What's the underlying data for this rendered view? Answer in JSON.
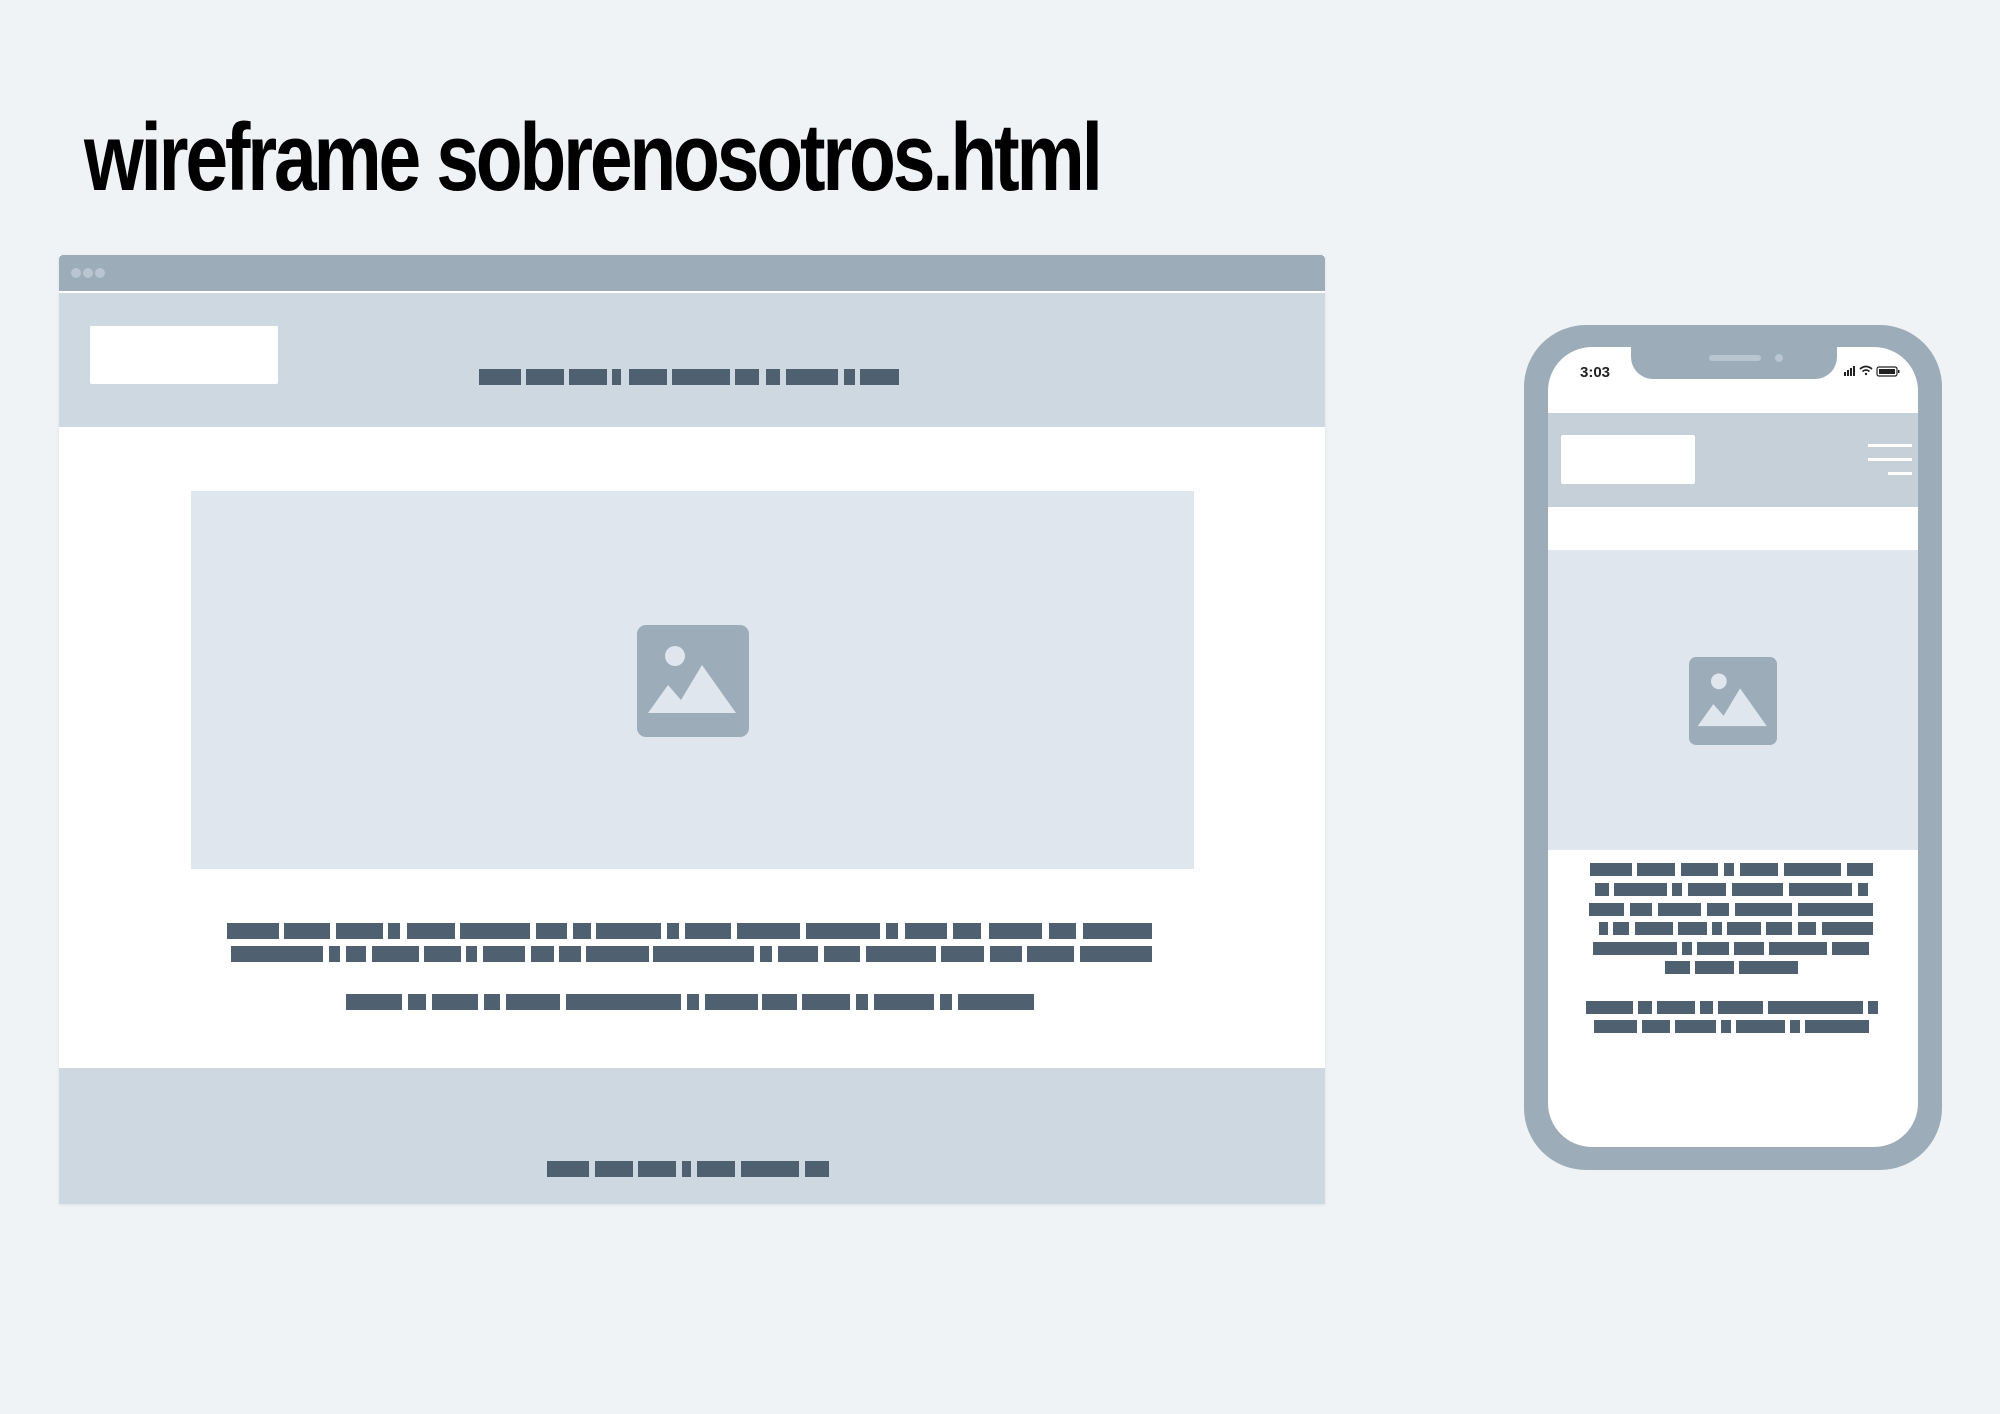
{
  "title": "wireframe sobrenosotros.html",
  "colors": {
    "background": "#eff3f6",
    "frame": "#9dacb9",
    "header": "#cdd8e0",
    "placeholder": "#e0e6ed",
    "text_block": "#4f6170"
  },
  "phone": {
    "status_time": "3:03",
    "icons": [
      "signal-icon",
      "wifi-icon",
      "battery-icon"
    ]
  },
  "icons": {
    "hero_image": "image-icon",
    "menu": "hamburger-menu-icon"
  }
}
